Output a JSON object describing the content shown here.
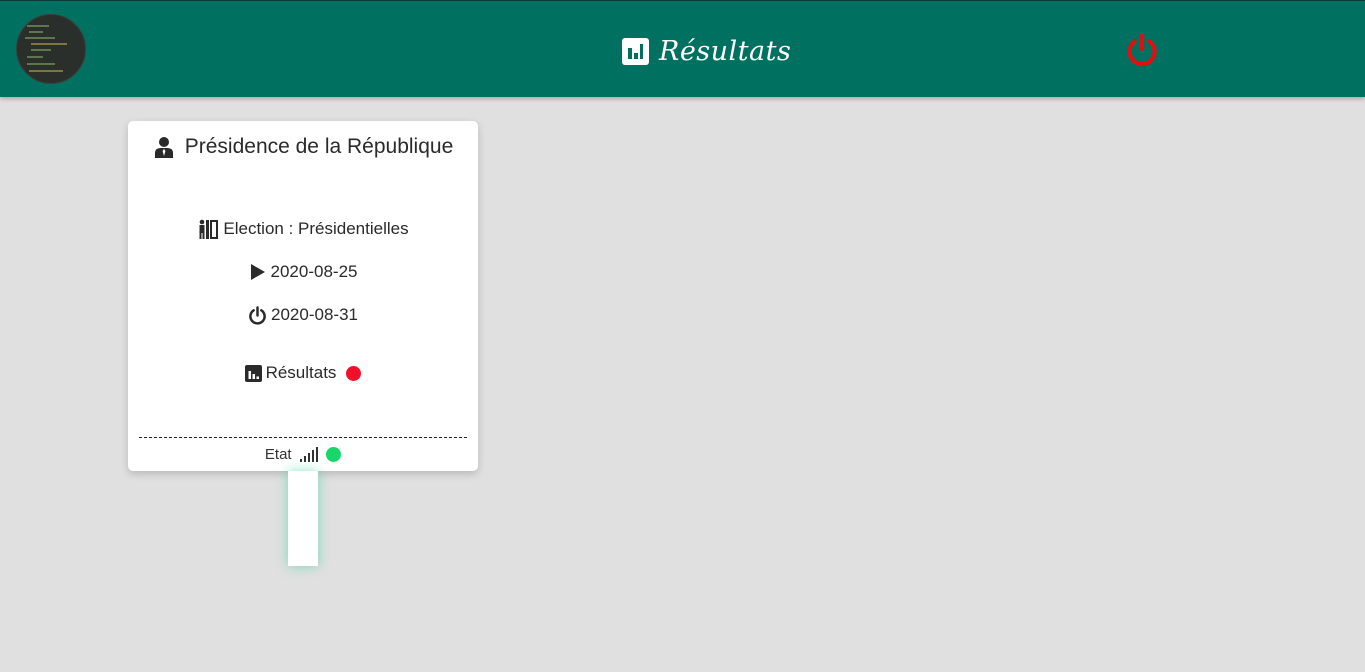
{
  "header": {
    "title": "Résultats",
    "title_icon": "bar-chart-icon",
    "avatar_icon": "code-screenshot-avatar",
    "logout_icon": "power-icon",
    "colors": {
      "bar": "#007060",
      "logout": "#e01010"
    }
  },
  "card": {
    "title": "Présidence de la République",
    "title_icon": "person-tie-icon",
    "election_label": "Election : Présidentielles",
    "election_icon": "voting-booth-icon",
    "start_date": "2020-08-25",
    "start_icon": "play-icon",
    "end_date": "2020-08-31",
    "end_icon": "power-icon",
    "results_label": "Résultats",
    "results_icon": "bar-chart-icon",
    "results_status_color": "#f0102a",
    "state_label": "Etat",
    "state_icon": "signal-icon",
    "state_status_color": "#18d66a"
  }
}
